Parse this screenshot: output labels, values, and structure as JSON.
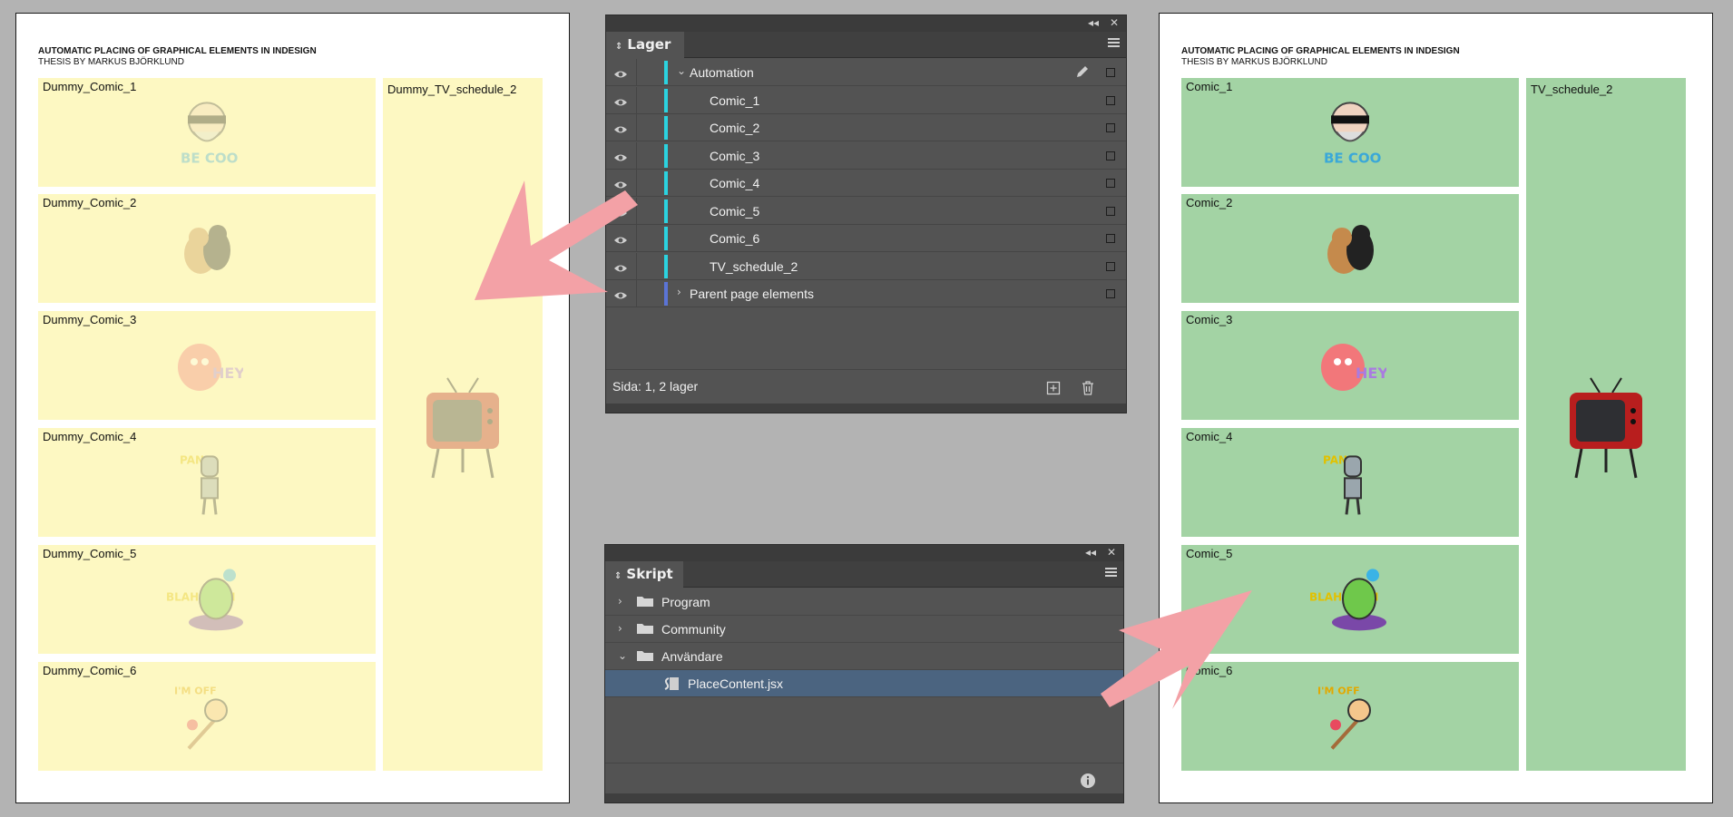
{
  "left_page": {
    "title": "AUTOMATIC PLACING OF GRAPHICAL ELEMENTS IN INDESIGN",
    "subtitle": "THESIS BY MARKUS BJÖRKLUND",
    "frames": [
      "Dummy_Comic_1",
      "Dummy_Comic_2",
      "Dummy_Comic_3",
      "Dummy_Comic_4",
      "Dummy_Comic_5",
      "Dummy_Comic_6"
    ],
    "tv_frame": "Dummy_TV_schedule_2"
  },
  "right_page": {
    "title": "AUTOMATIC PLACING OF GRAPHICAL ELEMENTS IN INDESIGN",
    "subtitle": "THESIS BY MARKUS BJÖRKLUND",
    "frames": [
      "Comic_1",
      "Comic_2",
      "Comic_3",
      "Comic_4",
      "Comic_5",
      "Comic_6"
    ],
    "tv_frame": "TV_schedule_2"
  },
  "artwork": {
    "comic_1_text": "BE COOL!",
    "comic_3_text": "HEY",
    "comic_4_text": "PAN",
    "comic_5_text": "BLAH BLAH",
    "comic_6_text": "I'M OFF"
  },
  "layers_panel": {
    "tab": "Lager",
    "layer_name": "Automation",
    "sublayers": [
      "Comic_1",
      "Comic_2",
      "Comic_3",
      "Comic_4",
      "Comic_5",
      "Comic_6",
      "TV_schedule_2"
    ],
    "parent_layer": "Parent page elements",
    "status": "Sida: 1, 2 lager",
    "layer_color": "#2bd3e0",
    "parent_color": "#5b74d6"
  },
  "scripts_panel": {
    "tab": "Skript",
    "folders": [
      "Program",
      "Community",
      "Användare"
    ],
    "script_file": "PlaceContent.jsx"
  },
  "icons": [
    "eye-icon",
    "pen-icon",
    "new-layer-icon",
    "trash-icon",
    "folder-icon",
    "script-file-icon",
    "info-icon",
    "panel-menu-icon",
    "collapse-icon",
    "close-icon"
  ]
}
